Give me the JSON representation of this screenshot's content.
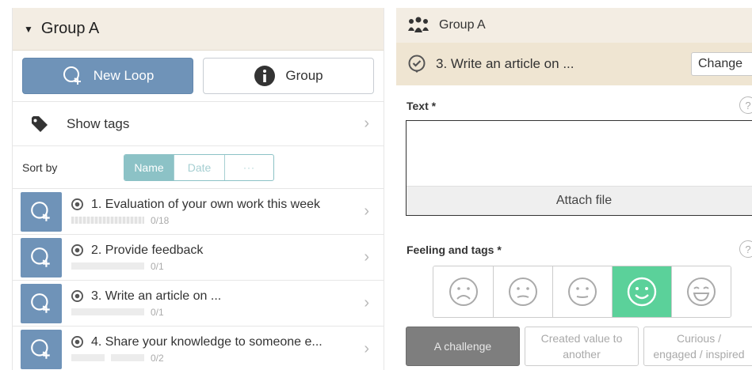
{
  "left": {
    "group_title": "Group A",
    "new_loop_label": "New Loop",
    "group_button_label": "Group",
    "show_tags_label": "Show tags",
    "sort_by_label": "Sort by",
    "sort_options": [
      "Name",
      "Date",
      "···"
    ],
    "loops": [
      {
        "title": "1. Evaluation of your own work this week",
        "progress": "0/18"
      },
      {
        "title": "2. Provide feedback",
        "progress": "0/1"
      },
      {
        "title": "3. Write an article on ...",
        "progress": "0/1"
      },
      {
        "title": "4. Share your knowledge to someone e...",
        "progress": "0/2"
      }
    ]
  },
  "right": {
    "group_title": "Group A",
    "loop_title": "3. Write an article on ...",
    "change_label": "Change",
    "text_label": "Text *",
    "attach_label": "Attach file",
    "feeling_label": "Feeling and tags *",
    "help_symbol": "?",
    "feelings": [
      "very-sad-face-icon",
      "sad-face-icon",
      "neutral-face-icon",
      "happy-face-icon",
      "very-happy-face-icon"
    ],
    "selected_feeling_index": 3,
    "tags": [
      {
        "label": "A challenge",
        "selected": true
      },
      {
        "label_line1": "Created value to",
        "label_line2": "another",
        "selected": false
      },
      {
        "label_line1": "Curious /",
        "label_line2": "engaged / inspired",
        "selected": false
      }
    ]
  },
  "colors": {
    "header_bg": "#f3ede3",
    "primary": "#6f93b8",
    "teal": "#8cc2c6",
    "selected_face": "#5bd19a",
    "selected_tag": "#7e7e7e"
  }
}
